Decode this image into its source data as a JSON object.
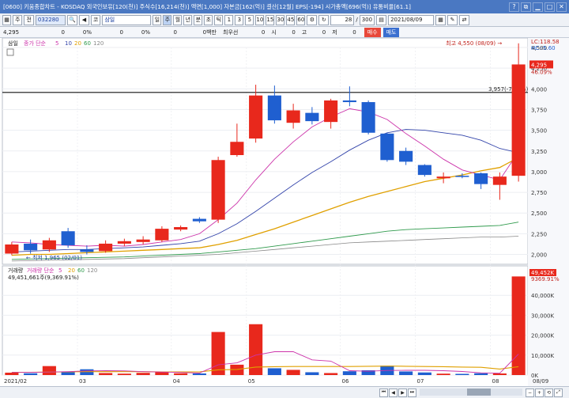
{
  "window": {
    "title": "[0600] 키움종합차트 - KOSDAQ 외국인보유[120(천)] 주식수[16,214(천)] 액면[1,000] 자본금[162(억)] 결산[12월] EPS[-194] 시가총액[696(억)] 유통비율[61.1]"
  },
  "toolbar": {
    "market": "주",
    "period_sel": "전",
    "stock_code": "032280",
    "stock_name": "삼일",
    "market_prefix": "코",
    "periods": [
      "일",
      "주",
      "월",
      "년",
      "분",
      "초",
      "틱"
    ],
    "minutes": [
      "1",
      "3",
      "5",
      "10",
      "15",
      "30",
      "45",
      "60"
    ],
    "count": "28",
    "count_total": "300",
    "date": "2021/08/09"
  },
  "inforow": {
    "price": "4,295",
    "v1": "0",
    "p1": "0%",
    "v2": "0",
    "p2": "0%",
    "v3": "0",
    "unit": "0백만",
    "label_best": "최우선",
    "v4": "0",
    "label_si": "시",
    "v5": "0",
    "label_go": "고",
    "v6": "0",
    "label_jeo": "저",
    "v7": "0",
    "buy": "매수",
    "sell": "매도"
  },
  "chart_data": [
    {
      "type": "candlestick",
      "title": "삼일",
      "legend": [
        {
          "name": "종가 단순",
          "color": "#cc33aa"
        },
        {
          "name": "5",
          "color": "#cc33aa"
        },
        {
          "name": "10",
          "color": "#3344aa"
        },
        {
          "name": "20",
          "color": "#e0a000"
        },
        {
          "name": "60",
          "color": "#2f9a4c"
        },
        {
          "name": "120",
          "color": "#888888"
        }
      ],
      "x_ticks": [
        "2021/02",
        "03",
        "04",
        "05",
        "06",
        "07",
        "08",
        "08/09"
      ],
      "y_ticks": [
        "4,500",
        "4,250",
        "4,000",
        "3,750",
        "3,500",
        "3,250",
        "3,000",
        "2,750",
        "2,500",
        "2,250",
        "2,000"
      ],
      "ylim": [
        1900,
        4500
      ],
      "candles": [
        {
          "o": 2010,
          "c": 2120,
          "h": 2150,
          "l": 1990,
          "up": true
        },
        {
          "o": 2130,
          "c": 2050,
          "h": 2180,
          "l": 2010,
          "up": false
        },
        {
          "o": 2060,
          "c": 2170,
          "h": 2200,
          "l": 2030,
          "up": true
        },
        {
          "o": 2280,
          "c": 2110,
          "h": 2320,
          "l": 2080,
          "up": false
        },
        {
          "o": 2060,
          "c": 2030,
          "h": 2110,
          "l": 2000,
          "up": false
        },
        {
          "o": 2040,
          "c": 2130,
          "h": 2170,
          "l": 2020,
          "up": true
        },
        {
          "o": 2130,
          "c": 2160,
          "h": 2190,
          "l": 2100,
          "up": true
        },
        {
          "o": 2150,
          "c": 2180,
          "h": 2220,
          "l": 2120,
          "up": true
        },
        {
          "o": 2170,
          "c": 2310,
          "h": 2340,
          "l": 2150,
          "up": true
        },
        {
          "o": 2300,
          "c": 2330,
          "h": 2350,
          "l": 2280,
          "up": true
        },
        {
          "o": 2430,
          "c": 2400,
          "h": 2450,
          "l": 2380,
          "up": false
        },
        {
          "o": 2420,
          "c": 3140,
          "h": 3180,
          "l": 2380,
          "up": true
        },
        {
          "o": 3200,
          "c": 3360,
          "h": 3580,
          "l": 3180,
          "up": true
        },
        {
          "o": 3400,
          "c": 3920,
          "h": 4050,
          "l": 3350,
          "up": true
        },
        {
          "o": 3920,
          "c": 3620,
          "h": 4040,
          "l": 3580,
          "up": false
        },
        {
          "o": 3590,
          "c": 3740,
          "h": 3820,
          "l": 3520,
          "up": true
        },
        {
          "o": 3710,
          "c": 3610,
          "h": 3780,
          "l": 3570,
          "up": false
        },
        {
          "o": 3600,
          "c": 3860,
          "h": 3880,
          "l": 3520,
          "up": true
        },
        {
          "o": 3860,
          "c": 3840,
          "h": 4030,
          "l": 3790,
          "up": false
        },
        {
          "o": 3840,
          "c": 3470,
          "h": 3860,
          "l": 3450,
          "up": false
        },
        {
          "o": 3460,
          "c": 3140,
          "h": 3470,
          "l": 3120,
          "up": false
        },
        {
          "o": 3250,
          "c": 3120,
          "h": 3290,
          "l": 3080,
          "up": false
        },
        {
          "o": 3080,
          "c": 2960,
          "h": 3090,
          "l": 2940,
          "up": false
        },
        {
          "o": 2940,
          "c": 2920,
          "h": 2990,
          "l": 2860,
          "up": true
        },
        {
          "o": 2950,
          "c": 2940,
          "h": 2980,
          "l": 2920,
          "up": false
        },
        {
          "o": 2980,
          "c": 2850,
          "h": 2990,
          "l": 2790,
          "up": false
        },
        {
          "o": 2840,
          "c": 2940,
          "h": 2990,
          "l": 2660,
          "up": true
        },
        {
          "o": 2950,
          "c": 4295,
          "h": 4550,
          "l": 2880,
          "up": true
        }
      ],
      "ma5": [
        2150,
        2140,
        2120,
        2110,
        2100,
        2110,
        2100,
        2120,
        2150,
        2180,
        2250,
        2420,
        2620,
        2900,
        3150,
        3360,
        3540,
        3660,
        3760,
        3720,
        3630,
        3460,
        3310,
        3150,
        3020,
        2960,
        2900,
        3240
      ],
      "ma10": [
        2030,
        2040,
        2050,
        2060,
        2060,
        2070,
        2080,
        2090,
        2110,
        2130,
        2160,
        2250,
        2370,
        2520,
        2680,
        2840,
        2990,
        3120,
        3260,
        3380,
        3470,
        3510,
        3500,
        3470,
        3440,
        3380,
        3280,
        3230
      ],
      "ma20": [
        1990,
        2000,
        2000,
        2010,
        2020,
        2030,
        2040,
        2050,
        2060,
        2070,
        2080,
        2120,
        2170,
        2240,
        2310,
        2390,
        2470,
        2550,
        2630,
        2700,
        2760,
        2820,
        2880,
        2920,
        2960,
        3010,
        3050,
        3170
      ],
      "ma60": [
        1940,
        1945,
        1950,
        1955,
        1960,
        1965,
        1970,
        1980,
        1990,
        2000,
        2010,
        2030,
        2050,
        2070,
        2100,
        2130,
        2160,
        2190,
        2220,
        2250,
        2280,
        2300,
        2310,
        2320,
        2330,
        2340,
        2350,
        2390
      ],
      "ma120": [
        1920,
        1925,
        1930,
        1935,
        1940,
        1945,
        1950,
        1960,
        1970,
        1980,
        1990,
        2000,
        2020,
        2040,
        2060,
        2080,
        2100,
        2120,
        2140,
        2150,
        2160,
        2170,
        2180,
        2190,
        2200,
        2210,
        2210,
        2220
      ],
      "hline": {
        "value": 3957,
        "label": "3,957(-7,87%)"
      },
      "annotations": [
        {
          "text": "최고 4,550 (08/09)",
          "value": 4550,
          "candle": 27,
          "side": "left"
        },
        {
          "text": "최저 1,965 (02/01)",
          "value": 1965,
          "candle": 0,
          "side": "right"
        }
      ],
      "right_labels": {
        "lc": "LC:118.58",
        "hc": "HC:-5.60",
        "price": "4,295",
        "pct": "46.09%"
      }
    },
    {
      "type": "bar",
      "title": "거래량",
      "legend": [
        {
          "name": "거래량 단순",
          "color": "#cc33aa"
        },
        {
          "name": "5",
          "color": "#cc33aa"
        },
        {
          "name": "20",
          "color": "#e0a000"
        },
        {
          "name": "60",
          "color": "#2f9a4c"
        },
        {
          "name": "120",
          "color": "#888888"
        }
      ],
      "header_value": "49,451,661주(9,369.91%)",
      "y_ticks": [
        "40,000K",
        "30,000K",
        "20,000K",
        "10,000K",
        "0K"
      ],
      "ylim": [
        0,
        50000
      ],
      "volumes": [
        1200,
        900,
        4500,
        1500,
        2900,
        1000,
        700,
        1100,
        1400,
        900,
        800,
        21600,
        5200,
        25500,
        3400,
        2600,
        1400,
        1000,
        1900,
        2400,
        4700,
        1800,
        1300,
        700,
        600,
        900,
        800,
        49452
      ],
      "vol_ma5": [
        1300,
        1350,
        1500,
        1700,
        2100,
        2200,
        2100,
        1700,
        1500,
        1300,
        1000,
        5100,
        6100,
        10000,
        11700,
        11700,
        7600,
        7000,
        2200,
        1900,
        2300,
        2400,
        2400,
        2200,
        1800,
        1100,
        900,
        10500
      ],
      "vol_ma20": [
        1400,
        1400,
        1500,
        1600,
        1700,
        1700,
        1700,
        1700,
        1600,
        1600,
        1600,
        2600,
        2800,
        4000,
        4200,
        4300,
        4300,
        4300,
        4300,
        4400,
        4500,
        4400,
        4300,
        4200,
        4000,
        3900,
        3000,
        4200
      ],
      "right_labels": {
        "vol": "49,452K",
        "pct": "9369.91%"
      }
    }
  ]
}
